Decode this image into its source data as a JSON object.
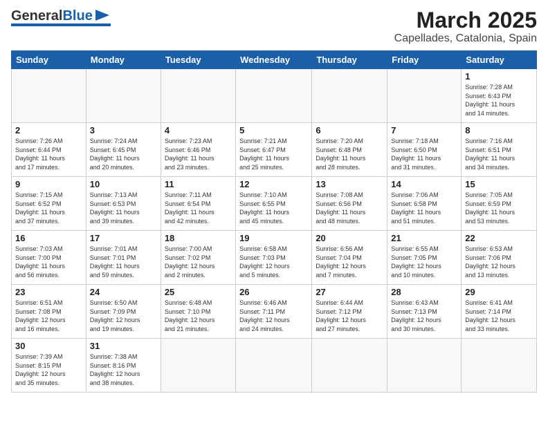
{
  "header": {
    "logo": {
      "general": "General",
      "blue": "Blue"
    },
    "title": "March 2025",
    "subtitle": "Capellades, Catalonia, Spain"
  },
  "weekdays": [
    "Sunday",
    "Monday",
    "Tuesday",
    "Wednesday",
    "Thursday",
    "Friday",
    "Saturday"
  ],
  "weeks": [
    [
      {
        "day": "",
        "info": ""
      },
      {
        "day": "",
        "info": ""
      },
      {
        "day": "",
        "info": ""
      },
      {
        "day": "",
        "info": ""
      },
      {
        "day": "",
        "info": ""
      },
      {
        "day": "",
        "info": ""
      },
      {
        "day": "1",
        "info": "Sunrise: 7:28 AM\nSunset: 6:43 PM\nDaylight: 11 hours\nand 14 minutes."
      }
    ],
    [
      {
        "day": "2",
        "info": "Sunrise: 7:26 AM\nSunset: 6:44 PM\nDaylight: 11 hours\nand 17 minutes."
      },
      {
        "day": "3",
        "info": "Sunrise: 7:24 AM\nSunset: 6:45 PM\nDaylight: 11 hours\nand 20 minutes."
      },
      {
        "day": "4",
        "info": "Sunrise: 7:23 AM\nSunset: 6:46 PM\nDaylight: 11 hours\nand 23 minutes."
      },
      {
        "day": "5",
        "info": "Sunrise: 7:21 AM\nSunset: 6:47 PM\nDaylight: 11 hours\nand 25 minutes."
      },
      {
        "day": "6",
        "info": "Sunrise: 7:20 AM\nSunset: 6:48 PM\nDaylight: 11 hours\nand 28 minutes."
      },
      {
        "day": "7",
        "info": "Sunrise: 7:18 AM\nSunset: 6:50 PM\nDaylight: 11 hours\nand 31 minutes."
      },
      {
        "day": "8",
        "info": "Sunrise: 7:16 AM\nSunset: 6:51 PM\nDaylight: 11 hours\nand 34 minutes."
      }
    ],
    [
      {
        "day": "9",
        "info": "Sunrise: 7:15 AM\nSunset: 6:52 PM\nDaylight: 11 hours\nand 37 minutes."
      },
      {
        "day": "10",
        "info": "Sunrise: 7:13 AM\nSunset: 6:53 PM\nDaylight: 11 hours\nand 39 minutes."
      },
      {
        "day": "11",
        "info": "Sunrise: 7:11 AM\nSunset: 6:54 PM\nDaylight: 11 hours\nand 42 minutes."
      },
      {
        "day": "12",
        "info": "Sunrise: 7:10 AM\nSunset: 6:55 PM\nDaylight: 11 hours\nand 45 minutes."
      },
      {
        "day": "13",
        "info": "Sunrise: 7:08 AM\nSunset: 6:56 PM\nDaylight: 11 hours\nand 48 minutes."
      },
      {
        "day": "14",
        "info": "Sunrise: 7:06 AM\nSunset: 6:58 PM\nDaylight: 11 hours\nand 51 minutes."
      },
      {
        "day": "15",
        "info": "Sunrise: 7:05 AM\nSunset: 6:59 PM\nDaylight: 11 hours\nand 53 minutes."
      }
    ],
    [
      {
        "day": "16",
        "info": "Sunrise: 7:03 AM\nSunset: 7:00 PM\nDaylight: 11 hours\nand 56 minutes."
      },
      {
        "day": "17",
        "info": "Sunrise: 7:01 AM\nSunset: 7:01 PM\nDaylight: 11 hours\nand 59 minutes."
      },
      {
        "day": "18",
        "info": "Sunrise: 7:00 AM\nSunset: 7:02 PM\nDaylight: 12 hours\nand 2 minutes."
      },
      {
        "day": "19",
        "info": "Sunrise: 6:58 AM\nSunset: 7:03 PM\nDaylight: 12 hours\nand 5 minutes."
      },
      {
        "day": "20",
        "info": "Sunrise: 6:56 AM\nSunset: 7:04 PM\nDaylight: 12 hours\nand 7 minutes."
      },
      {
        "day": "21",
        "info": "Sunrise: 6:55 AM\nSunset: 7:05 PM\nDaylight: 12 hours\nand 10 minutes."
      },
      {
        "day": "22",
        "info": "Sunrise: 6:53 AM\nSunset: 7:06 PM\nDaylight: 12 hours\nand 13 minutes."
      }
    ],
    [
      {
        "day": "23",
        "info": "Sunrise: 6:51 AM\nSunset: 7:08 PM\nDaylight: 12 hours\nand 16 minutes."
      },
      {
        "day": "24",
        "info": "Sunrise: 6:50 AM\nSunset: 7:09 PM\nDaylight: 12 hours\nand 19 minutes."
      },
      {
        "day": "25",
        "info": "Sunrise: 6:48 AM\nSunset: 7:10 PM\nDaylight: 12 hours\nand 21 minutes."
      },
      {
        "day": "26",
        "info": "Sunrise: 6:46 AM\nSunset: 7:11 PM\nDaylight: 12 hours\nand 24 minutes."
      },
      {
        "day": "27",
        "info": "Sunrise: 6:44 AM\nSunset: 7:12 PM\nDaylight: 12 hours\nand 27 minutes."
      },
      {
        "day": "28",
        "info": "Sunrise: 6:43 AM\nSunset: 7:13 PM\nDaylight: 12 hours\nand 30 minutes."
      },
      {
        "day": "29",
        "info": "Sunrise: 6:41 AM\nSunset: 7:14 PM\nDaylight: 12 hours\nand 33 minutes."
      }
    ],
    [
      {
        "day": "30",
        "info": "Sunrise: 7:39 AM\nSunset: 8:15 PM\nDaylight: 12 hours\nand 35 minutes."
      },
      {
        "day": "31",
        "info": "Sunrise: 7:38 AM\nSunset: 8:16 PM\nDaylight: 12 hours\nand 38 minutes."
      },
      {
        "day": "",
        "info": ""
      },
      {
        "day": "",
        "info": ""
      },
      {
        "day": "",
        "info": ""
      },
      {
        "day": "",
        "info": ""
      },
      {
        "day": "",
        "info": ""
      }
    ]
  ]
}
